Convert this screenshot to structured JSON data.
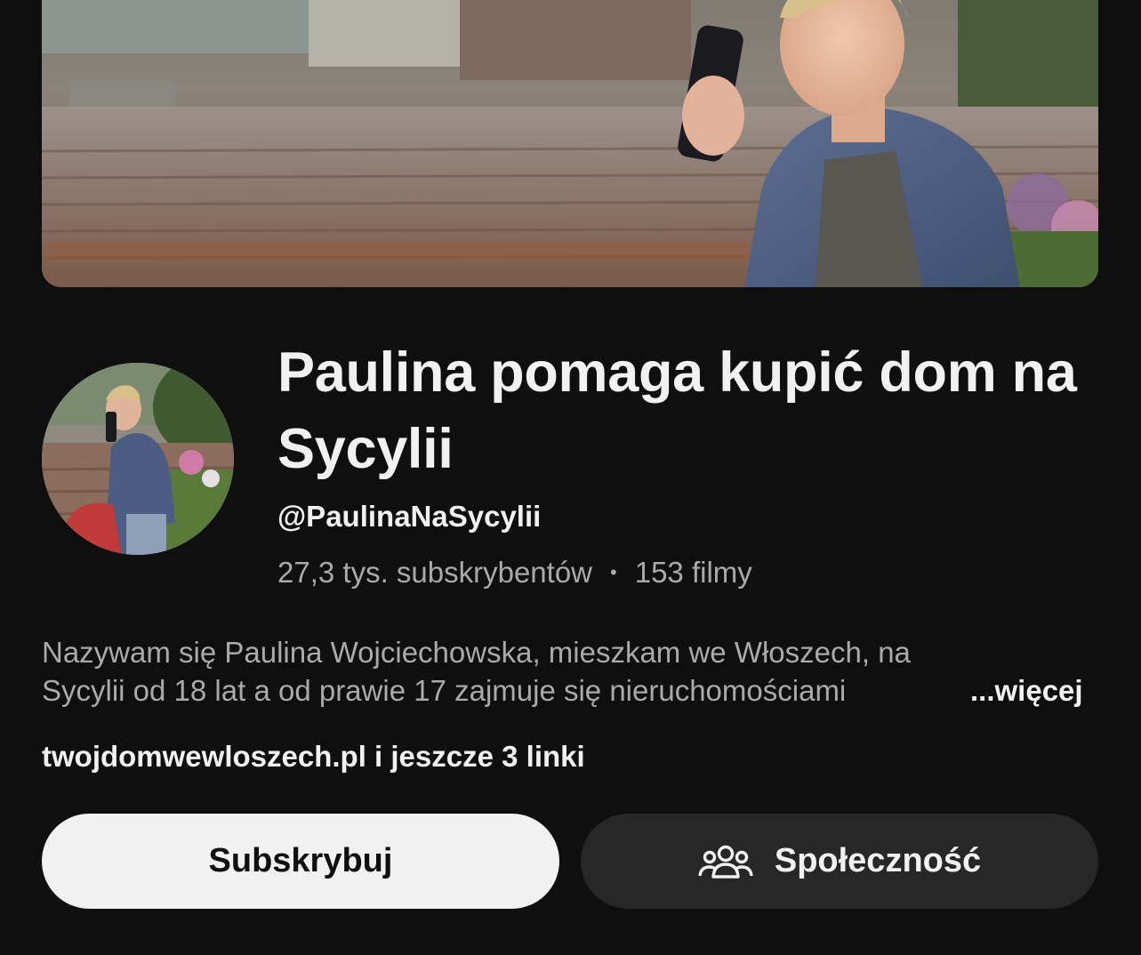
{
  "channel": {
    "title": "Paulina pomaga kupić dom na Sycylii",
    "handle": "@PaulinaNaSycylii",
    "subscribers": "27,3 tys. subskrybentów",
    "separator": "•",
    "videos": "153 filmy"
  },
  "description": {
    "line1": "Nazywam się Paulina Wojciechowska, mieszkam we Włoszech, na",
    "line2": "Sycylii od 18 lat a od prawie 17 zajmuje się  nieruchomościami",
    "more_label": "...więcej"
  },
  "links": {
    "label": "twojdomwewloszech.pl i jeszcze 3 linki"
  },
  "buttons": {
    "subscribe_label": "Subskrybuj",
    "community_label": "Społeczność",
    "community_icon": "people-icon"
  },
  "colors": {
    "background": "#0f0f0f",
    "subscribe_bg": "#f1f1f1",
    "community_bg": "#272727",
    "secondary_text": "#aaaaaa"
  }
}
